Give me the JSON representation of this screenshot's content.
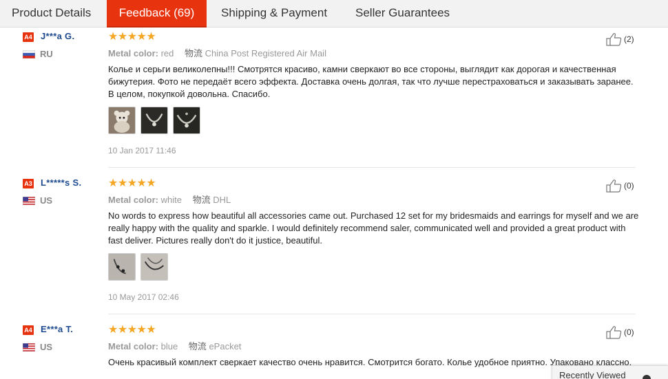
{
  "tabs": [
    {
      "label": "Product Details",
      "active": false
    },
    {
      "label": "Feedback (69)",
      "active": true
    },
    {
      "label": "Shipping & Payment",
      "active": false
    },
    {
      "label": "Seller Guarantees",
      "active": false
    }
  ],
  "reviews": [
    {
      "level": "A4",
      "user": "J***a G.",
      "country": "RU",
      "stars": "★★★★★",
      "rating": 5,
      "attr_label": "Metal color:",
      "attr_value": "red",
      "ship_label": "物流",
      "ship_value": "China Post Registered Air Mail",
      "text": "Колье и серьги великолепны!!! Смотрятся красиво, камни сверкают во все стороны, выглядит как дорогая и качественная бижутерия. Фото не передаёт всего эффекта. Доставка очень долгая, так что лучше перестраховаться и заказывать заранее. В целом, покупкой довольна. Спасибо.",
      "date": "10 Jan 2017 11:46",
      "helpful": "(2)"
    },
    {
      "level": "A3",
      "user": "L*****s S.",
      "country": "US",
      "stars": "★★★★★",
      "rating": 5,
      "attr_label": "Metal color:",
      "attr_value": "white",
      "ship_label": "物流",
      "ship_value": "DHL",
      "text": "No words to express how beautiful all accessories came out. Purchased 12 set for my bridesmaids and earrings for myself and we are really happy with the quality and sparkle. I would definitely recommend saler, communicated well and provided a great product with fast deliver. Pictures really don't do it justice, beautiful.",
      "date": "10 May 2017 02:46",
      "helpful": "(0)"
    },
    {
      "level": "A4",
      "user": "E***a T.",
      "country": "US",
      "stars": "★★★★★",
      "rating": 5,
      "attr_label": "Metal color:",
      "attr_value": "blue",
      "ship_label": "物流",
      "ship_value": "ePacket",
      "text": "Очень красивый комплект сверкает качество очень нравится. Смотрится богато. Колье удобное приятно. Упаковано классно.",
      "helpful": "(0)"
    }
  ],
  "recently_viewed": "Recently Viewed",
  "colors": {
    "accent": "#e8330f",
    "star": "#f5a623",
    "username": "#1d4a8f"
  }
}
